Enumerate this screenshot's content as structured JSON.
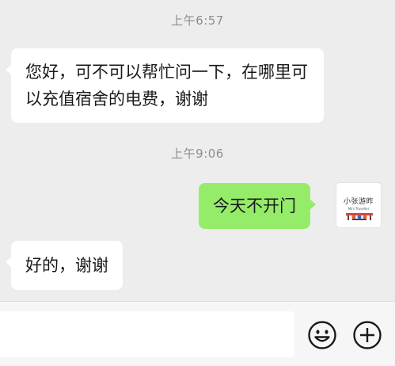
{
  "messages": {
    "timestamp_1": "上午6:57",
    "incoming_1": "您好，可不可以帮忙问一下，在哪里可以充值宿舍的电费，谢谢",
    "timestamp_2": "上午9:06",
    "outgoing_1": "今天不开门",
    "incoming_2": "好的，谢谢"
  },
  "avatar": {
    "title": "小张游昨",
    "subtitle": "Mini Traveller"
  },
  "input_bar": {
    "placeholder": "",
    "emoji_icon": "emoji-icon",
    "add_icon": "plus-circle-icon"
  },
  "colors": {
    "background": "#ededed",
    "incoming_bubble": "#ffffff",
    "outgoing_bubble": "#95ec69"
  }
}
